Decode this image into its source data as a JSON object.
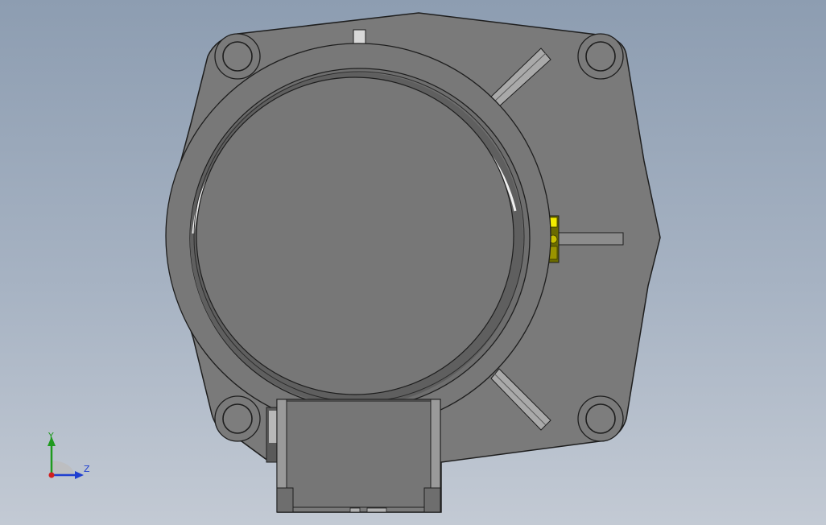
{
  "viewport": {
    "background_top": "#8d9db1",
    "background_bottom": "#c3cad4"
  },
  "model": {
    "body_color": "#7a7a7a",
    "face_color": "#777777",
    "edge_color": "#1e1e1e",
    "highlight_color": "#e0e0e0",
    "fitting_color": "#e6e000"
  },
  "triad": {
    "y_label": "Y",
    "z_label": "Z",
    "y_color": "#1f9a1f",
    "z_color": "#1f3fd0",
    "x_color": "#d01f1f"
  }
}
